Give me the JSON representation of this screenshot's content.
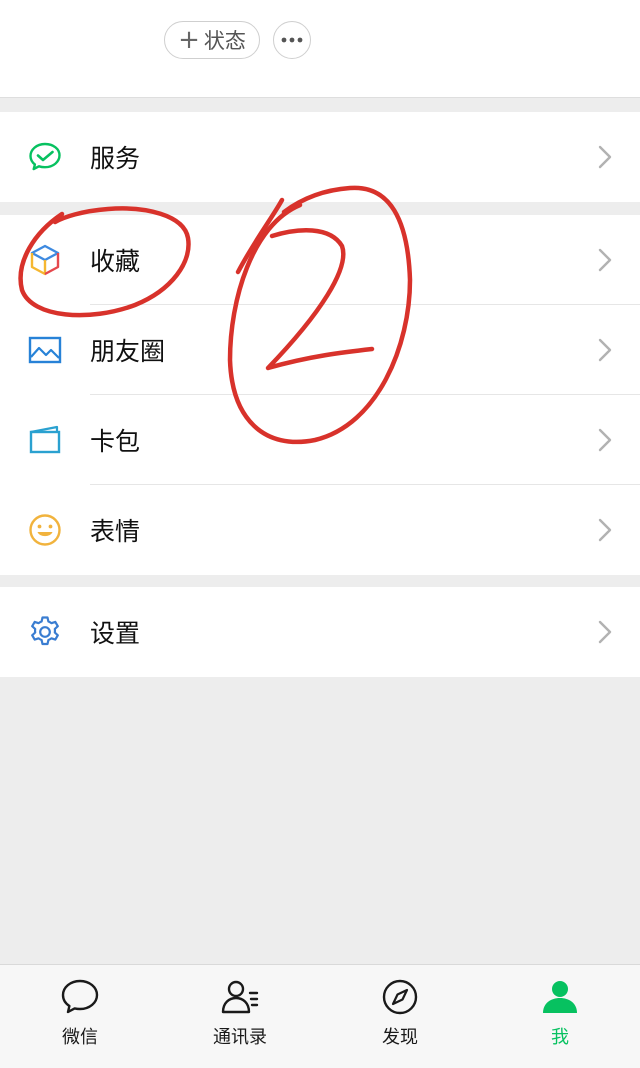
{
  "header": {
    "status_button_label": "状态",
    "status_button_icon": "plus-icon",
    "more_button_icon": "more-icon"
  },
  "menu": {
    "service": {
      "label": "服务",
      "icon": "wechat-pay-icon",
      "color": "#07c160"
    },
    "favorites": {
      "label": "收藏",
      "icon": "cube-icon"
    },
    "moments": {
      "label": "朋友圈",
      "icon": "picture-icon",
      "color": "#2782d7"
    },
    "cards": {
      "label": "卡包",
      "icon": "card-icon",
      "color": "#2aa1d0"
    },
    "stickers": {
      "label": "表情",
      "icon": "smiley-icon",
      "color": "#f1b33d"
    },
    "settings": {
      "label": "设置",
      "icon": "gear-icon",
      "color": "#3a7dd1"
    }
  },
  "tabbar": {
    "chats": {
      "label": "微信",
      "icon": "chat-bubble-icon"
    },
    "contacts": {
      "label": "通讯录",
      "icon": "contacts-icon"
    },
    "discover": {
      "label": "发现",
      "icon": "compass-icon"
    },
    "me": {
      "label": "我",
      "icon": "person-icon",
      "active": true,
      "color": "#07c160"
    }
  },
  "annotation": {
    "handwritten_mark": "2",
    "color": "#d8322b"
  }
}
